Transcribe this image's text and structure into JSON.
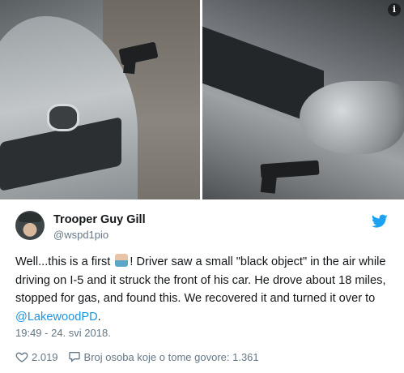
{
  "photos": [
    {
      "name": "left-photo"
    },
    {
      "name": "right-photo"
    }
  ],
  "info_icon": "i",
  "author": {
    "name": "Trooper Guy Gill",
    "handle": "@wspd1pio"
  },
  "tweet": {
    "text_before": "Well...this is a first ",
    "text_after_emoji": "! Driver saw a small \"black object\" in the air while driving on I-5 and it struck the front of his car.  He drove about 18 miles, stopped for gas, and found this.  We recovered it and turned it over to ",
    "mention": "@LakewoodPD",
    "text_end": ".",
    "emoji": "man-facepalming-emoji"
  },
  "timestamp": "19:49 - 24. svi 2018.",
  "actions": {
    "likes": "2.019",
    "replies_label": "Broj osoba koje o tome govore: 1.361"
  },
  "colors": {
    "accent": "#1b95e0",
    "secondary_text": "#657786",
    "heart": "#657786"
  }
}
